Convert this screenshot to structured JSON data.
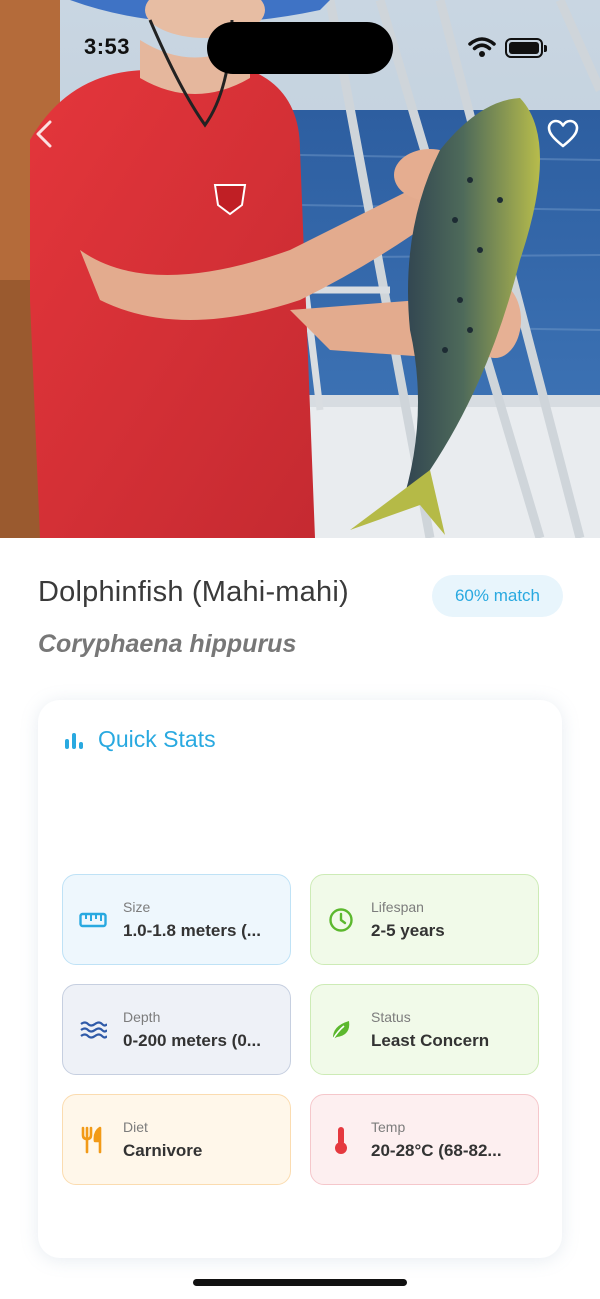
{
  "status_bar": {
    "time": "3:53"
  },
  "species": {
    "common_name": "Dolphinfish (Mahi-mahi)",
    "scientific_name": "Coryphaena hippurus",
    "match": "60% match"
  },
  "quick_stats": {
    "title": "Quick Stats",
    "items": [
      {
        "label": "Size",
        "value": "1.0-1.8 meters (...",
        "icon": "ruler-icon",
        "color": "#29a9e0"
      },
      {
        "label": "Lifespan",
        "value": "2-5 years",
        "icon": "clock-icon",
        "color": "#5cb82e"
      },
      {
        "label": "Depth",
        "value": "0-200 meters (0...",
        "icon": "waves-icon",
        "color": "#2f5aa8"
      },
      {
        "label": "Status",
        "value": "Least Concern",
        "icon": "leaf-icon",
        "color": "#5cb82e"
      },
      {
        "label": "Diet",
        "value": "Carnivore",
        "icon": "utensils-icon",
        "color": "#f29a17"
      },
      {
        "label": "Temp",
        "value": "20-28°C (68-82...",
        "icon": "thermometer-icon",
        "color": "#e5393f"
      }
    ]
  },
  "colors": {
    "accent": "#29a9e0",
    "badge_bg": "#e8f5fc"
  }
}
